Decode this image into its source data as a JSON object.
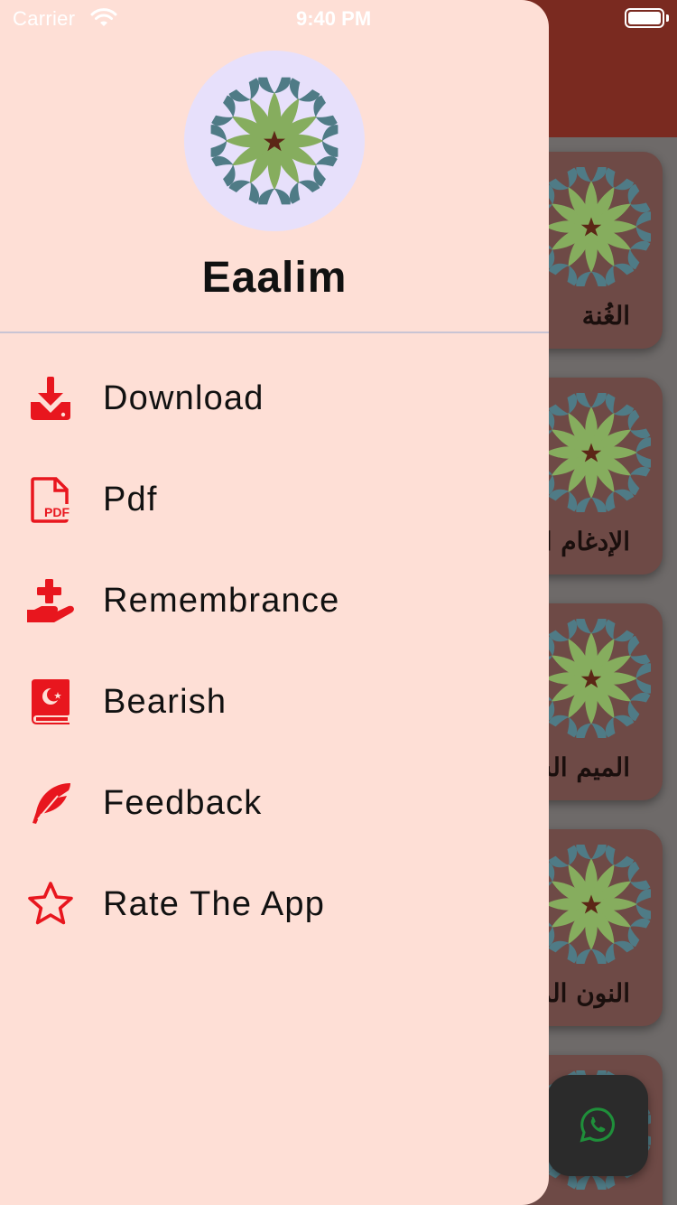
{
  "status_bar": {
    "carrier": "Carrier",
    "time": "9:40 PM"
  },
  "drawer": {
    "app_name": "Eaalim",
    "menu": [
      {
        "label": "Download",
        "icon": "download-icon"
      },
      {
        "label": "Pdf",
        "icon": "pdf-icon"
      },
      {
        "label": "Remembrance",
        "icon": "hand-plus-icon"
      },
      {
        "label": "Bearish",
        "icon": "quran-book-icon"
      },
      {
        "label": "Feedback",
        "icon": "feather-icon"
      },
      {
        "label": "Rate The App",
        "icon": "star-icon"
      }
    ]
  },
  "background": {
    "cards": [
      {
        "label": "الغُنة"
      },
      {
        "label": "الإدغام المتماثلين"
      },
      {
        "label": "الميم الساكنة"
      },
      {
        "label": "النون المشددة"
      }
    ],
    "fab_icon": "whatsapp-icon"
  },
  "colors": {
    "drawer_bg": "#fedfd6",
    "accent": "#e8161e",
    "header": "#7a2a20",
    "avatar_bg": "#e7e0fb"
  }
}
